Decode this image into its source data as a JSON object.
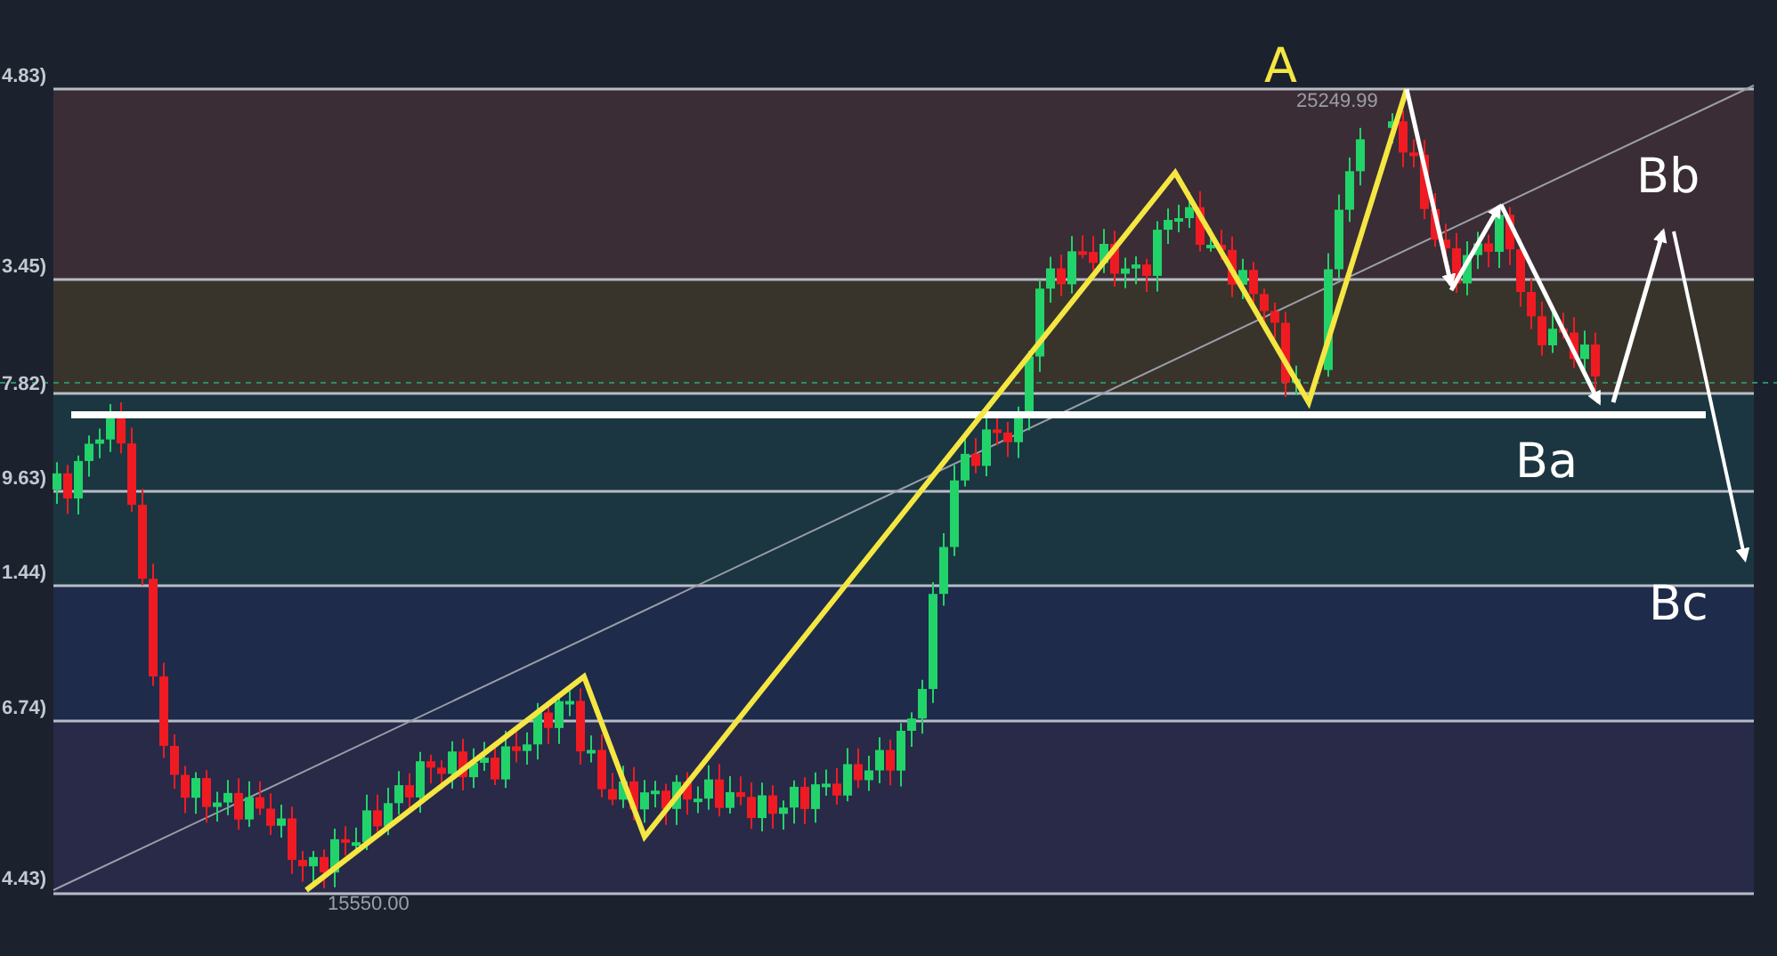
{
  "price_labels": [
    "4.83)",
    "3.45)",
    "7.82)",
    "9.63)",
    "1.44)",
    "6.74)",
    "4.43)"
  ],
  "high_label": "25249.99",
  "low_label": "15550.00",
  "wave_labels": [
    {
      "text": "A",
      "color": "#f5e642"
    },
    {
      "text": "Bb",
      "color": "#ffffff"
    },
    {
      "text": "Ba",
      "color": "#ffffff"
    },
    {
      "text": "Bc",
      "color": "#ffffff"
    }
  ]
}
